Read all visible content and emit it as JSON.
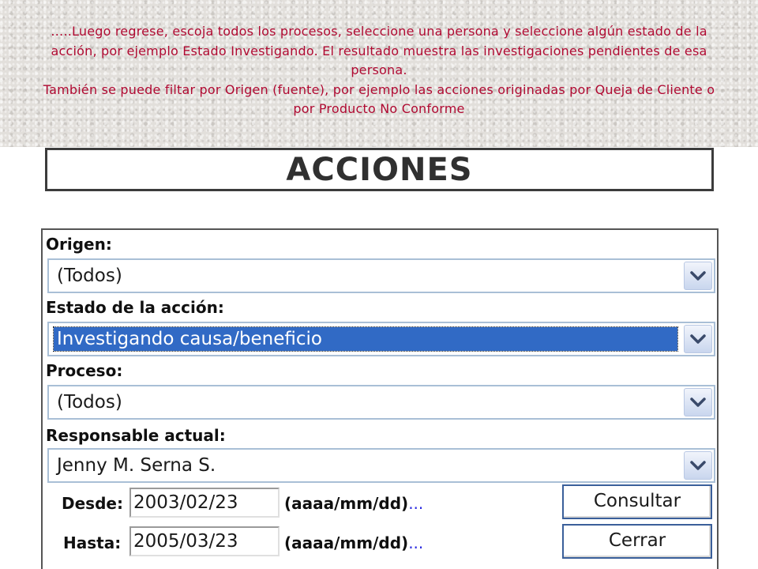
{
  "caption": {
    "line1": "…..Luego regrese, escoja todos los procesos, seleccione una persona y seleccione algún estado de la acción, por ejemplo Estado Investigando. El resultado muestra las investigaciones pendientes de esa persona.",
    "line2": "También se puede filtar por Origen (fuente), por ejemplo las acciones originadas por Queja de Cliente o por Producto No Conforme"
  },
  "title": "ACCIONES",
  "form": {
    "origen": {
      "label": "Origen:",
      "value": "(Todos)"
    },
    "estado": {
      "label": "Estado de la acción:",
      "value": "Investigando causa/beneficio"
    },
    "proceso": {
      "label": "Proceso:",
      "value": "(Todos)"
    },
    "responsable": {
      "label": "Responsable actual:",
      "value": "Jenny M. Serna S."
    },
    "desde": {
      "label": "Desde:",
      "value": "2003/02/23",
      "hint": "(aaaa/mm/dd)",
      "dots": "..."
    },
    "hasta": {
      "label": "Hasta:",
      "value": "2005/03/23",
      "hint": "(aaaa/mm/dd)",
      "dots": "..."
    },
    "buttons": {
      "consultar": "Consultar",
      "cerrar": "Cerrar"
    }
  },
  "icons": {
    "dropdown": "chevron-down-icon"
  },
  "colors": {
    "caption_text": "#b00a32",
    "selection": "#316ac5",
    "select_border": "#a9bfd6"
  }
}
